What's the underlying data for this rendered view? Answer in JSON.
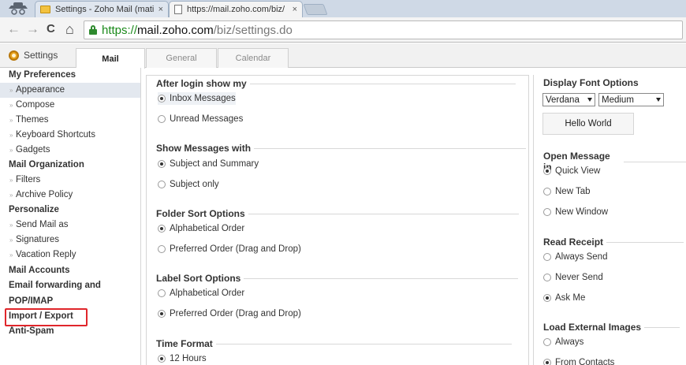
{
  "browser": {
    "tabs": [
      {
        "title": "Settings - Zoho Mail (mati",
        "active": false
      },
      {
        "title": "https://mail.zoho.com/biz/",
        "active": true
      }
    ],
    "close_glyph": "×",
    "url_scheme": "https://",
    "url_host": "mail.zoho.com",
    "url_path": "/biz/settings.do",
    "back_glyph": "←",
    "forward_glyph": "→",
    "reload_glyph": "C",
    "home_glyph": "⌂"
  },
  "settings_header": {
    "title": "Settings",
    "tabs": [
      {
        "label": "Mail",
        "active": true
      },
      {
        "label": "General",
        "active": false
      },
      {
        "label": "Calendar",
        "active": false
      }
    ]
  },
  "sidebar": {
    "items": [
      {
        "label": "My Preferences",
        "type": "header"
      },
      {
        "label": "Appearance",
        "type": "sub",
        "selected": true
      },
      {
        "label": "Compose",
        "type": "sub"
      },
      {
        "label": "Themes",
        "type": "sub"
      },
      {
        "label": "Keyboard Shortcuts",
        "type": "sub"
      },
      {
        "label": "Gadgets",
        "type": "sub"
      },
      {
        "label": "Mail Organization",
        "type": "header"
      },
      {
        "label": "Filters",
        "type": "sub"
      },
      {
        "label": "Archive Policy",
        "type": "sub"
      },
      {
        "label": "Personalize",
        "type": "header"
      },
      {
        "label": "Send Mail as",
        "type": "sub"
      },
      {
        "label": "Signatures",
        "type": "sub"
      },
      {
        "label": "Vacation Reply",
        "type": "sub"
      },
      {
        "label": "Mail Accounts",
        "type": "header"
      },
      {
        "label": "Email forwarding and",
        "type": "header"
      },
      {
        "label": "POP/IMAP",
        "type": "header"
      },
      {
        "label": "Import / Export",
        "type": "header",
        "highlighted": true
      },
      {
        "label": "Anti-Spam",
        "type": "header"
      }
    ]
  },
  "main": {
    "after_login": {
      "title": "After login show my",
      "options": [
        "Inbox Messages",
        "Unread Messages"
      ],
      "selected": 0
    },
    "show_messages": {
      "title": "Show Messages with",
      "options": [
        "Subject and Summary",
        "Subject only"
      ],
      "selected": 0
    },
    "folder_sort": {
      "title": "Folder Sort Options",
      "options": [
        "Alphabetical Order",
        "Preferred Order (Drag and Drop)"
      ],
      "selected": 0
    },
    "label_sort": {
      "title": "Label Sort Options",
      "options": [
        "Alphabetical Order",
        "Preferred Order (Drag and Drop)"
      ],
      "selected": 1
    },
    "time_format": {
      "title": "Time Format",
      "options": [
        "12 Hours"
      ],
      "selected": 0
    }
  },
  "right": {
    "display_font": {
      "title": "Display Font Options",
      "font_value": "Verdana",
      "size_value": "Medium",
      "preview_text": "Hello World"
    },
    "open_message": {
      "title": "Open Message in",
      "options": [
        "Quick View",
        "New Tab",
        "New Window"
      ],
      "selected": 0
    },
    "read_receipt": {
      "title": "Read Receipt",
      "options": [
        "Always Send",
        "Never Send",
        "Ask Me"
      ],
      "selected": 2
    },
    "external_images": {
      "title": "Load External Images",
      "options": [
        "Always",
        "From Contacts"
      ],
      "selected": 1
    }
  },
  "colors": {
    "highlight_border": "#e0262b",
    "url_scheme": "#1b8a1b",
    "selected_bg": "#e3e8ef"
  },
  "icons": [
    "incognito-icon",
    "envelope-icon",
    "page-icon",
    "lock-icon",
    "gear-icon"
  ]
}
